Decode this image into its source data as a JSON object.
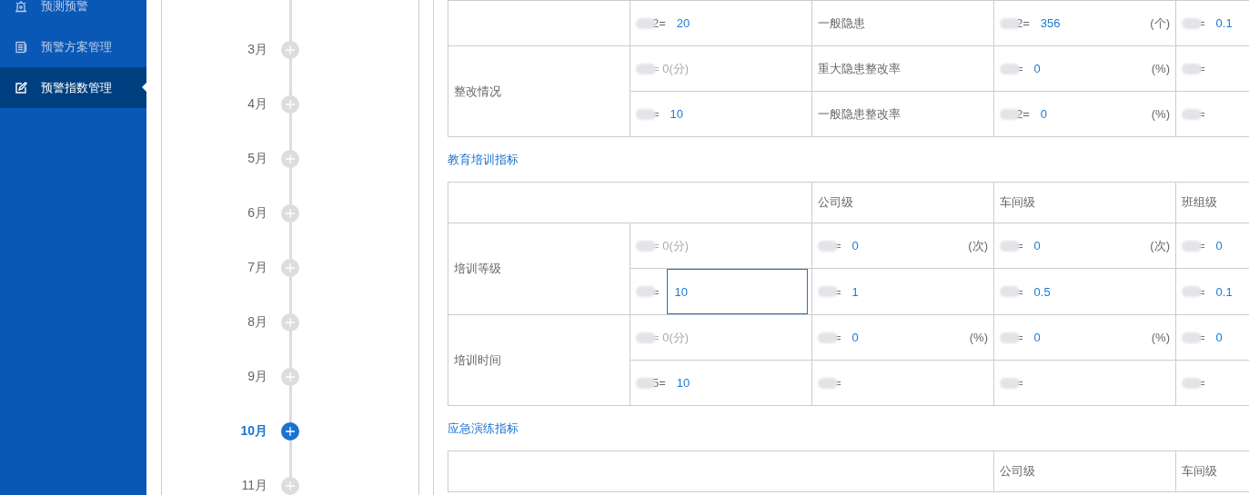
{
  "sidebar": {
    "items": [
      {
        "kind": "alarm",
        "label": "预测预警",
        "selected": false
      },
      {
        "kind": "document",
        "label": "预警方案管理",
        "selected": false
      },
      {
        "kind": "edit",
        "label": "预警指数管理",
        "selected": true
      }
    ]
  },
  "timeline": {
    "months": [
      {
        "label": "3月",
        "selected": false
      },
      {
        "label": "4月",
        "selected": false
      },
      {
        "label": "5月",
        "selected": false
      },
      {
        "label": "6月",
        "selected": false
      },
      {
        "label": "7月",
        "selected": false
      },
      {
        "label": "8月",
        "selected": false
      },
      {
        "label": "9月",
        "selected": false
      },
      {
        "label": "10月",
        "selected": true
      },
      {
        "label": "11月",
        "selected": false
      }
    ]
  },
  "tables": [
    {
      "groups": [
        {
          "rows": [
            [
              {
                "kind": "metric",
                "prefix": "2=",
                "value": "20"
              },
              {
                "kind": "text",
                "text": "一般隐患"
              },
              {
                "kind": "metric",
                "prefix": "2=",
                "value": "356",
                "unit": "(个)"
              },
              {
                "kind": "metric",
                "prefix": "=",
                "value": "0.1"
              }
            ]
          ]
        },
        {
          "label": "整改情况",
          "rows": [
            [
              {
                "kind": "score",
                "text": "= 0(分)"
              },
              {
                "kind": "text",
                "text": "重大隐患整改率"
              },
              {
                "kind": "metric",
                "prefix": "=",
                "value": "0",
                "unit": "(%)"
              },
              {
                "kind": "metric",
                "prefix": "="
              }
            ],
            [
              {
                "kind": "metric",
                "prefix": "=",
                "value": "10"
              },
              {
                "kind": "text",
                "text": "一般隐患整改率"
              },
              {
                "kind": "metric",
                "prefix": "2=",
                "value": "0",
                "unit": "(%)"
              },
              {
                "kind": "metric",
                "prefix": "="
              }
            ]
          ]
        }
      ]
    },
    {
      "title": "教育培训指标",
      "header": [
        "公司级",
        "车间级",
        "班组级"
      ],
      "groups": [
        {
          "label": "培训等级",
          "rows": [
            [
              {
                "kind": "score",
                "text": "= 0(分)"
              },
              {
                "kind": "metric",
                "prefix": "=",
                "value": "0",
                "unit": "(次)"
              },
              {
                "kind": "metric",
                "prefix": "=",
                "value": "0",
                "unit": "(次)"
              },
              {
                "kind": "metric",
                "prefix": "=",
                "value": "0"
              }
            ],
            [
              {
                "kind": "input",
                "prefix": "=",
                "value": "10",
                "focused": true
              },
              {
                "kind": "metric",
                "prefix": "=",
                "value": "1"
              },
              {
                "kind": "metric",
                "prefix": "=",
                "value": "0.5"
              },
              {
                "kind": "metric",
                "prefix": "=",
                "value": "0.1"
              }
            ]
          ]
        },
        {
          "label": "培训时间",
          "rows": [
            [
              {
                "kind": "score",
                "text": "= 0(分)"
              },
              {
                "kind": "metric",
                "prefix": "=",
                "value": "0",
                "unit": "(%)"
              },
              {
                "kind": "metric",
                "prefix": "=",
                "value": "0",
                "unit": "(%)"
              },
              {
                "kind": "metric",
                "prefix": "=",
                "value": "0"
              }
            ],
            [
              {
                "kind": "metric",
                "prefix": "5=",
                "value": "10"
              },
              {
                "kind": "metric",
                "prefix": "="
              },
              {
                "kind": "metric",
                "prefix": "="
              },
              {
                "kind": "metric",
                "prefix": "="
              }
            ]
          ]
        }
      ]
    },
    {
      "title": "应急演练指标",
      "header": [
        "公司级",
        "车间级"
      ]
    }
  ]
}
